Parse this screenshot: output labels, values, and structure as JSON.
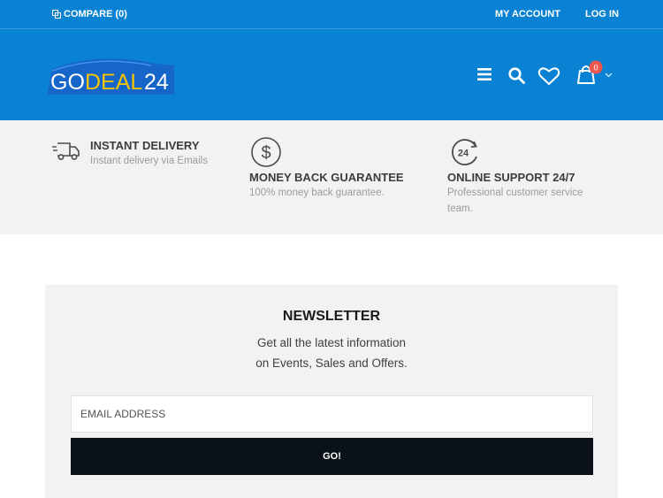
{
  "topbar": {
    "compare_label": "COMPARE (0)",
    "my_account_label": "MY ACCOUNT",
    "login_label": "LOG IN"
  },
  "header": {
    "logo_text_go": "GO",
    "logo_text_deal": "DEAL",
    "logo_text_24": "24",
    "cart_count": "0",
    "icons": [
      "menu-icon",
      "search-icon",
      "heart-icon",
      "cart-icon",
      "chevron-down-icon"
    ]
  },
  "features": [
    {
      "icon": "truck-icon",
      "title": "INSTANT DELIVERY",
      "desc_lines": [
        "Instant delivery via Emails"
      ]
    },
    {
      "icon": "dollar-icon",
      "title": "MONEY BACK GUARANTEE",
      "desc_lines": [
        "100% money back guarantee."
      ]
    },
    {
      "icon": "support-24-icon",
      "title": "ONLINE SUPPORT 24/7",
      "desc_lines": [
        "Professional customer service",
        "team."
      ]
    }
  ],
  "newsletter": {
    "title": "NEWSLETTER",
    "line1": "Get all the latest information",
    "line2": "on Events, Sales and Offers.",
    "email_placeholder": "EMAIL ADDRESS",
    "button_label": "GO!"
  },
  "colors": {
    "brand_blue": "#0a82d3",
    "logo_yellow": "#f5c400",
    "badge_red": "#f0564e",
    "button_dark": "#0a1118"
  }
}
